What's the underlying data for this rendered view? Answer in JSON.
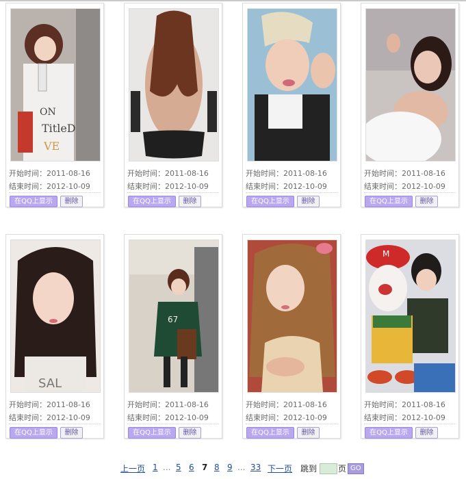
{
  "cards": [
    {
      "start_label": "开始时间：2011-08-16",
      "end_label": "结束时间：2012-10-09",
      "show_qq_label": "在QQ上显示",
      "delete_label": "删除"
    },
    {
      "start_label": "开始时间：2011-08-16",
      "end_label": "结束时间：2012-10-09",
      "show_qq_label": "在QQ上显示",
      "delete_label": "删除"
    },
    {
      "start_label": "开始时间：2011-08-16",
      "end_label": "结束时间：2012-10-09",
      "show_qq_label": "在QQ上显示",
      "delete_label": "删除"
    },
    {
      "start_label": "开始时间：2011-08-16",
      "end_label": "结束时间：2012-10-09",
      "show_qq_label": "在QQ上显示",
      "delete_label": "删除"
    },
    {
      "start_label": "开始时间：2011-08-16",
      "end_label": "结束时间：2012-10-09",
      "show_qq_label": "在QQ上显示",
      "delete_label": "删除"
    },
    {
      "start_label": "开始时间：2011-08-16",
      "end_label": "结束时间：2012-10-09",
      "show_qq_label": "在QQ上显示",
      "delete_label": "删除"
    },
    {
      "start_label": "开始时间：2011-08-16",
      "end_label": "结束时间：2012-10-09",
      "show_qq_label": "在QQ上显示",
      "delete_label": "删除"
    },
    {
      "start_label": "开始时间：2011-08-16",
      "end_label": "结束时间：2012-10-09",
      "show_qq_label": "在QQ上显示",
      "delete_label": "删除"
    }
  ],
  "pagination": {
    "prev": "上一页",
    "next": "下一页",
    "pages": [
      "1",
      "5",
      "6",
      "7",
      "8",
      "9",
      "33"
    ],
    "ellipsis": "...",
    "current": "7",
    "jump_to": "跳到",
    "page_unit": "页",
    "go": "GO",
    "jump_value": ""
  },
  "colors": {
    "accent": "#b9a8f0",
    "link": "#1f4fa3",
    "jump_input_bg": "#d9ecd9"
  }
}
